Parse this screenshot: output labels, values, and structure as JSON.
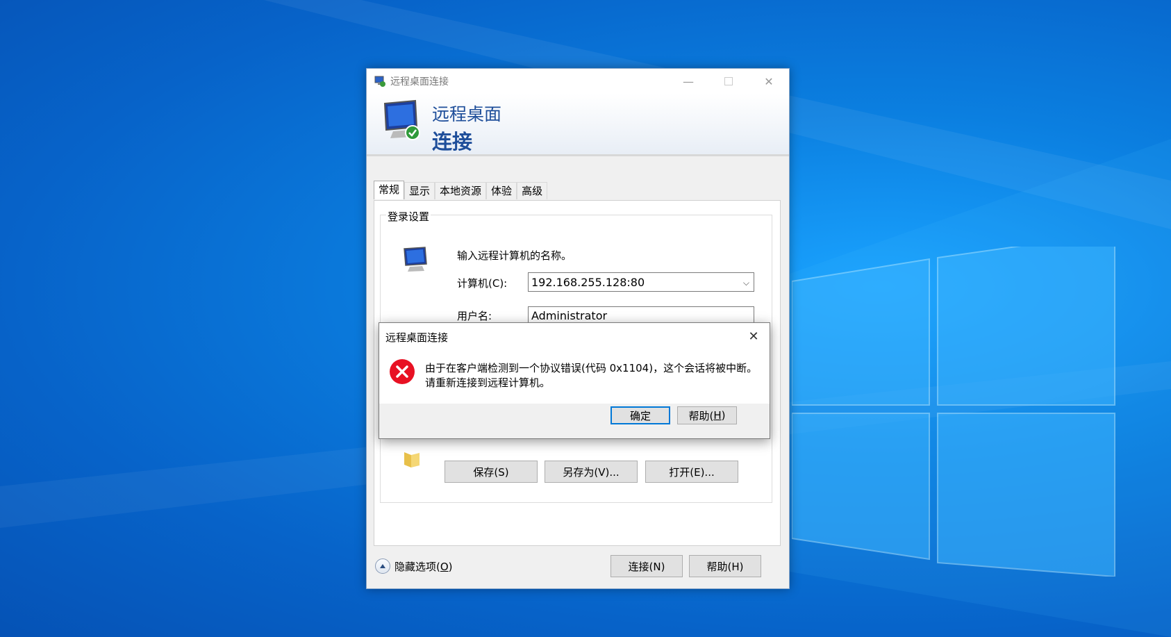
{
  "window": {
    "title": "远程桌面连接",
    "header_line1": "远程桌面",
    "header_line2": "连接"
  },
  "tabs": [
    "常规",
    "显示",
    "本地资源",
    "体验",
    "高级"
  ],
  "general": {
    "group_title": "登录设置",
    "prompt": "输入远程计算机的名称。",
    "computer_label": "计算机(C):",
    "computer_value": "192.168.255.128:80",
    "username_label": "用户名:",
    "username_value": "Administrator",
    "save_label": "保存(S)",
    "save_as_label": "另存为(V)...",
    "open_label": "打开(E)..."
  },
  "footer": {
    "hide_options_prefix": "隐藏选项(",
    "hide_options_key": "O",
    "hide_options_suffix": ")",
    "connect_label": "连接(N)",
    "help_label": "帮助(H)"
  },
  "error_dialog": {
    "title": "远程桌面连接",
    "message_line1": "由于在客户端检测到一个协议错误(代码 0x1104)，这个会话将被中断。",
    "message_line2": "请重新连接到远程计算机。",
    "ok_label": "确定",
    "help_prefix": "帮助(",
    "help_key": "H",
    "help_suffix": ")"
  },
  "colors": {
    "header_text": "#1e4e9a",
    "error_red": "#e81123",
    "desktop_blue": "#0b7fe0"
  }
}
